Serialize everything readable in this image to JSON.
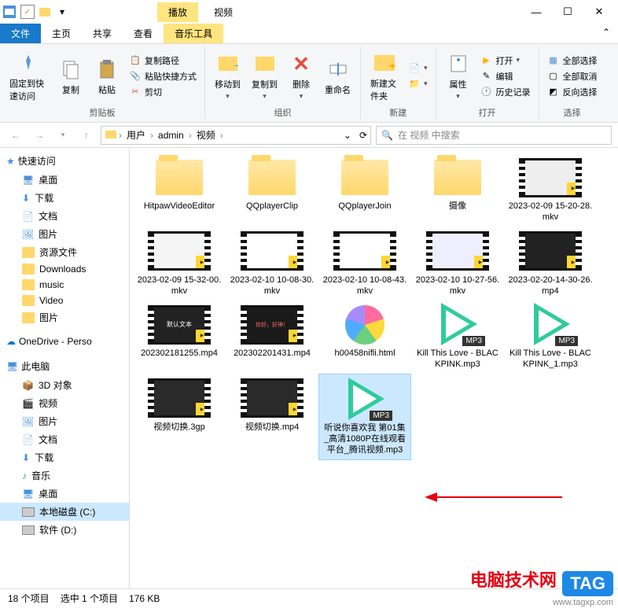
{
  "window": {
    "play_tab": "播放",
    "title": "视频",
    "minimize": "—",
    "maximize": "☐",
    "close": "✕"
  },
  "tabs": {
    "file": "文件",
    "home": "主页",
    "share": "共享",
    "view": "查看",
    "music": "音乐工具"
  },
  "ribbon": {
    "pin": "固定到快速访问",
    "copy": "复制",
    "paste": "粘贴",
    "copy_path": "复制路径",
    "paste_shortcut": "粘贴快捷方式",
    "cut": "剪切",
    "clipboard_group": "剪贴板",
    "move_to": "移动到",
    "copy_to": "复制到",
    "delete": "删除",
    "rename": "重命名",
    "organize_group": "组织",
    "new_folder": "新建文件夹",
    "new_group": "新建",
    "properties": "属性",
    "open": "打开",
    "edit": "编辑",
    "history": "历史记录",
    "open_group": "打开",
    "select_all": "全部选择",
    "select_none": "全部取消",
    "invert_selection": "反向选择",
    "select_group": "选择"
  },
  "breadcrumb": {
    "c1": "用户",
    "c2": "admin",
    "c3": "视频"
  },
  "search": {
    "placeholder": "在 视频 中搜索"
  },
  "sidebar": {
    "quick_access": "快速访问",
    "desktop": "桌面",
    "downloads": "下载",
    "documents": "文档",
    "pictures": "图片",
    "resources": "资源文件",
    "dl_folder": "Downloads",
    "music": "music",
    "video": "Video",
    "pictures2": "图片",
    "onedrive": "OneDrive - Perso",
    "this_pc": "此电脑",
    "objects_3d": "3D 对象",
    "videos": "视频",
    "pictures3": "图片",
    "documents2": "文档",
    "downloads2": "下载",
    "music2": "音乐",
    "desktop2": "桌面",
    "drive_c": "本地磁盘 (C:)",
    "drive_d": "软件 (D:)"
  },
  "files": {
    "f1": "HitpawVideoEditor",
    "f2": "QQplayerClip",
    "f3": "QQplayerJoin",
    "f4": "摄像",
    "f5": "2023-02-09 15-20-28.mkv",
    "f6": "2023-02-09 15-32-00.mkv",
    "f7": "2023-02-10 10-08-30.mkv",
    "f8": "2023-02-10 10-08-43.mkv",
    "f9": "2023-02-10 10-27-56.mkv",
    "f10": "2023-02-20-14-30-26.mp4",
    "f11": "202302181255.mp4",
    "f12": "202302201431.mp4",
    "f13": "h00458nifli.html",
    "f14": "Kill This Love - BLACKPINK.mp3",
    "f15": "Kill This Love - BLACKPINK_1.mp3",
    "f16": "视频切换.3gp",
    "f17": "视频切换.mp4",
    "f18": "听说你喜欢我 第01集_高清1080P在线观看平台_腾讯视频.mp3"
  },
  "status": {
    "count": "18 个项目",
    "selected": "选中 1 个项目",
    "size": "176 KB"
  },
  "watermark": {
    "line1": "电脑技术网",
    "line2": "www.tagxp.com",
    "tag": "TAG"
  }
}
